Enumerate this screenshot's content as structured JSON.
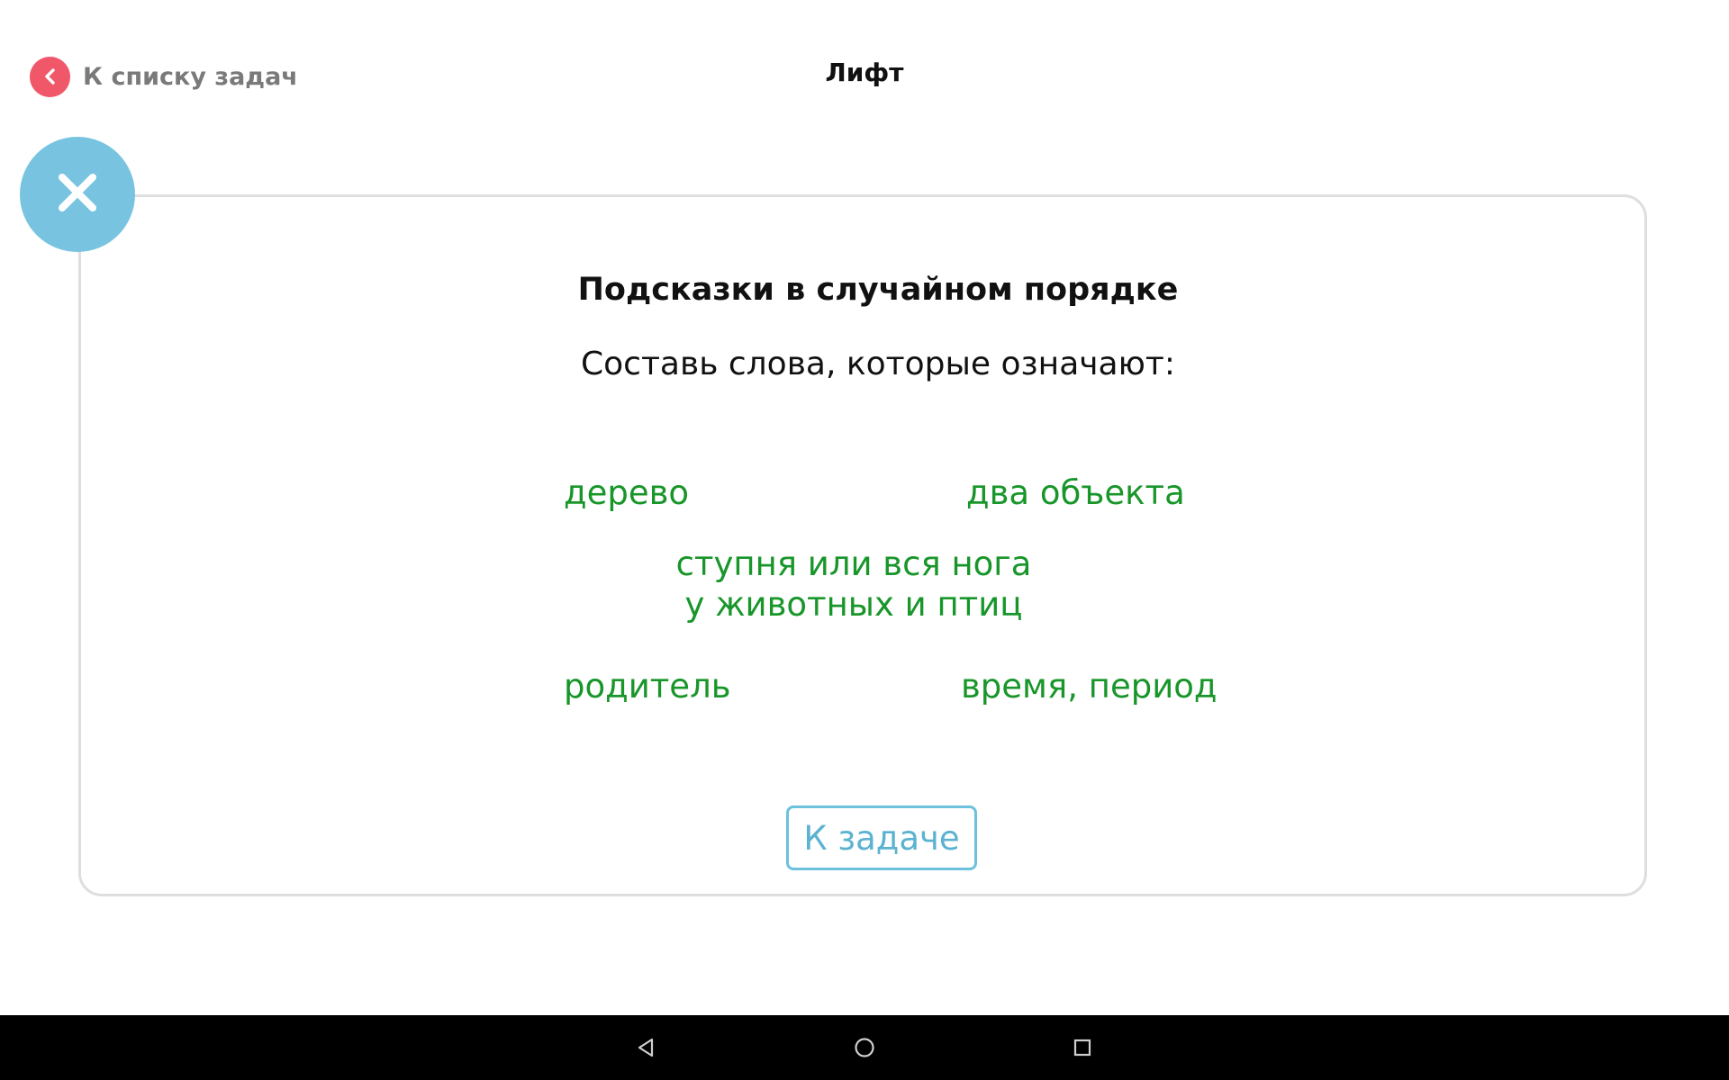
{
  "header": {
    "back_label": "К списку задач",
    "title": "Лифт"
  },
  "card": {
    "heading": "Подсказки в случайном порядке",
    "instruction": "Составь слова, которые означают:",
    "hints": [
      "дерево",
      "два объекта",
      "ступня или вся нога",
      "у животных и птиц",
      "родитель",
      "время, период"
    ],
    "button_label": "К задаче"
  },
  "icons": {
    "back": "chevron-left-icon",
    "close": "close-icon",
    "nav_back": "triangle-back-icon",
    "nav_home": "circle-home-icon",
    "nav_recents": "square-recents-icon"
  },
  "colors": {
    "back_circle": "#f0586a",
    "close_circle": "#78c4e0",
    "hint_text": "#18962a",
    "button_border": "#6cc1dc",
    "card_border": "#dedede"
  }
}
